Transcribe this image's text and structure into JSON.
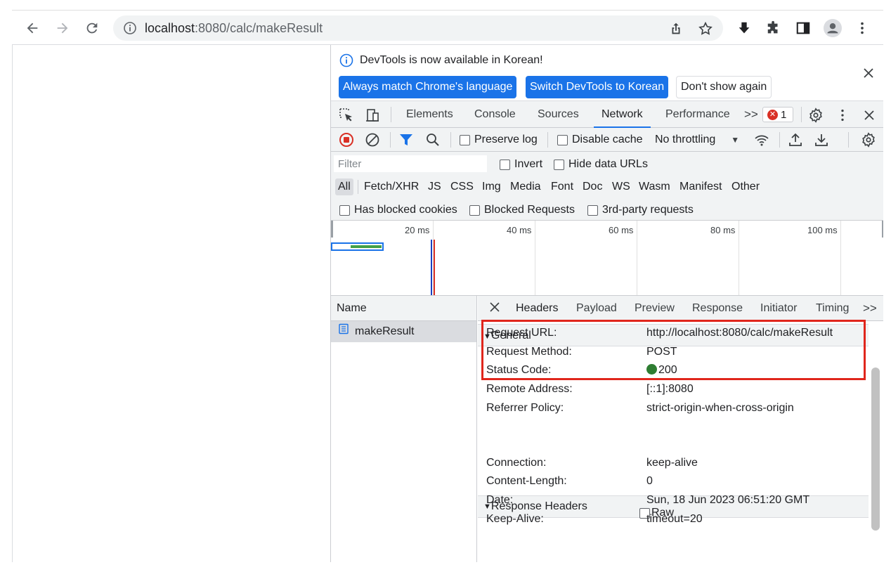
{
  "browser": {
    "url_host": "localhost",
    "url_rest": ":8080/calc/makeResult"
  },
  "infobar": {
    "message": "DevTools is now available in Korean!",
    "btn_match": "Always match Chrome's language",
    "btn_switch": "Switch DevTools to Korean",
    "btn_dont": "Don't show again"
  },
  "main_tabs": [
    "Elements",
    "Console",
    "Sources",
    "Network",
    "Performance"
  ],
  "error_count": "1",
  "net_toolbar": {
    "preserve_log": "Preserve log",
    "disable_cache": "Disable cache",
    "throttling": "No throttling"
  },
  "filter": {
    "placeholder": "Filter",
    "invert": "Invert",
    "hide_data_urls": "Hide data URLs"
  },
  "types": [
    "All",
    "Fetch/XHR",
    "JS",
    "CSS",
    "Img",
    "Media",
    "Font",
    "Doc",
    "WS",
    "Wasm",
    "Manifest",
    "Other"
  ],
  "blocked": {
    "has_blocked_cookies": "Has blocked cookies",
    "blocked_requests": "Blocked Requests",
    "third_party": "3rd-party requests"
  },
  "timeline_ticks": [
    "20 ms",
    "40 ms",
    "60 ms",
    "80 ms",
    "100 ms"
  ],
  "name_column": {
    "header": "Name",
    "rows": [
      "makeResult"
    ]
  },
  "detail_tabs": [
    "Headers",
    "Payload",
    "Preview",
    "Response",
    "Initiator",
    "Timing"
  ],
  "general": {
    "title": "General",
    "rows": [
      {
        "k": "Request URL:",
        "v": "http://localhost:8080/calc/makeResult"
      },
      {
        "k": "Request Method:",
        "v": "POST"
      },
      {
        "k": "Status Code:",
        "v": "200"
      },
      {
        "k": "Remote Address:",
        "v": "[::1]:8080"
      },
      {
        "k": "Referrer Policy:",
        "v": "strict-origin-when-cross-origin"
      }
    ]
  },
  "response_headers": {
    "title": "Response Headers",
    "raw": "Raw",
    "rows": [
      {
        "k": "Connection:",
        "v": "keep-alive"
      },
      {
        "k": "Content-Length:",
        "v": "0"
      },
      {
        "k": "Date:",
        "v": "Sun, 18 Jun 2023 06:51:20 GMT"
      },
      {
        "k": "Keep-Alive:",
        "v": "timeout=20"
      }
    ]
  },
  "colors": {
    "accent": "#1a73e8",
    "error": "#d93025",
    "status_ok": "#2e7d32",
    "highlight": "#e0261c"
  }
}
